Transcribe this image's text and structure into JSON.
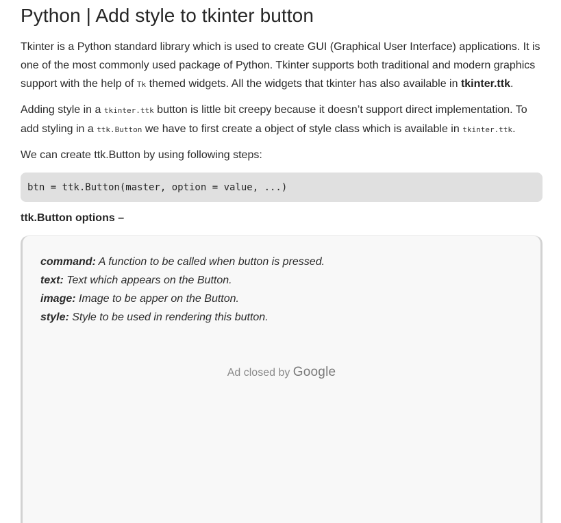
{
  "title": "Python | Add style to tkinter button",
  "intro": {
    "t1": "Tkinter is a Python standard library which is used to create GUI (Graphical User Interface) applications. It is one of the most commonly used package of Python. Tkinter supports both traditional and modern graphics support with the help of ",
    "code1": "Tk",
    "t2": " themed widgets. All the widgets that tkinter has also available in ",
    "strong1": "tkinter.ttk",
    "t3": "."
  },
  "para2": {
    "t1": "Adding style in a ",
    "code1": "tkinter.ttk",
    "t2": " button is little bit creepy because it doesn’t support direct implementation. To add styling in a ",
    "code2": "ttk.Button",
    "t3": " we have to first create a object of style class which is available in ",
    "code3": "tkinter.ttk",
    "t4": "."
  },
  "para3": "We can create ttk.Button by using following steps:",
  "code_block": "btn = ttk.Button(master, option = value, ...)",
  "options_heading": "ttk.Button options –",
  "options": [
    {
      "key": "command:",
      "desc": " A function to be called when button is pressed."
    },
    {
      "key": "text:",
      "desc": " Text which appears on the Button."
    },
    {
      "key": "image:",
      "desc": " Image to be apper on the Button."
    },
    {
      "key": "style:",
      "desc": " Style to be used in rendering this button."
    }
  ],
  "ad": {
    "prefix": "Ad closed by ",
    "brand": "Google"
  }
}
